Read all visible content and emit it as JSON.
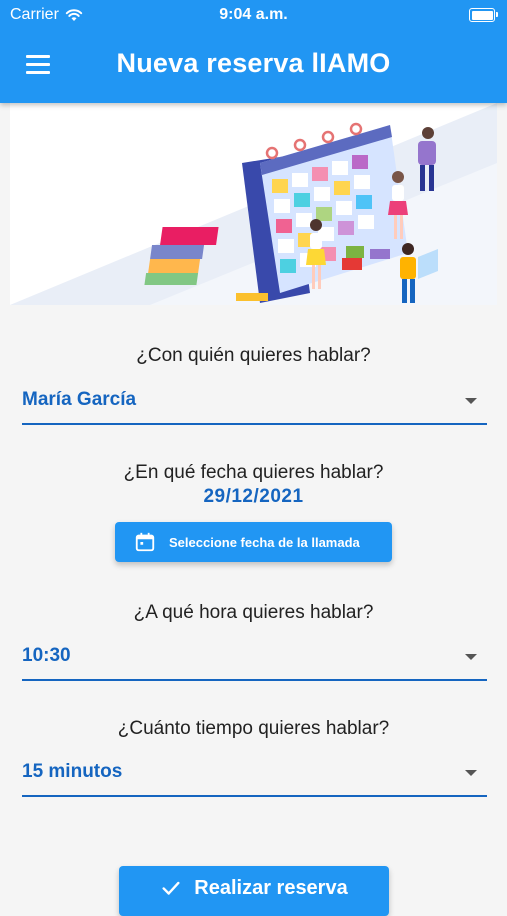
{
  "status_bar": {
    "carrier": "Carrier",
    "time": "9:04 a.m."
  },
  "header": {
    "title": "Nueva reserva lIAMO"
  },
  "form": {
    "who": {
      "label": "¿Con quién quieres hablar?",
      "value": "María García"
    },
    "date": {
      "label": "¿En qué fecha quieres hablar?",
      "value": "29/12/2021",
      "button_label": "Seleccione fecha de la llamada"
    },
    "hour": {
      "label": "¿A qué hora quieres hablar?",
      "value": "10:30"
    },
    "duration": {
      "label": "¿Cuánto tiempo quieres hablar?",
      "value": "15 minutos"
    },
    "submit_label": "Realizar reserva"
  },
  "colors": {
    "primary": "#2196f3",
    "accent_text": "#1565c0",
    "background": "#f5f5f5"
  },
  "icons": [
    "wifi-icon",
    "battery-icon",
    "menu-icon",
    "calendar-icon",
    "check-icon",
    "chevron-down-icon"
  ]
}
